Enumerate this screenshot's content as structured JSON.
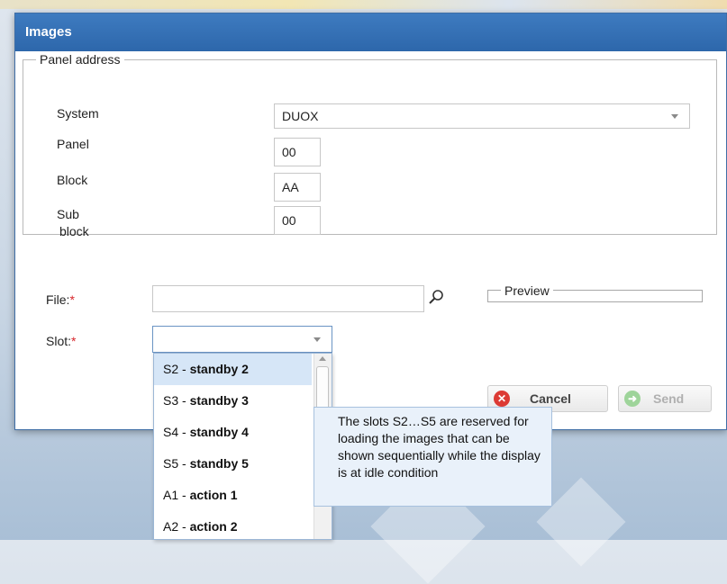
{
  "dialog": {
    "title": "Images",
    "panel_address": {
      "legend": "Panel address",
      "system": {
        "label": "System",
        "value": "DUOX"
      },
      "panel": {
        "label": "Panel",
        "value": "00"
      },
      "block": {
        "label": "Block",
        "value": "AA"
      },
      "sub_block": {
        "label_line1": "Sub",
        "label_line2": "block",
        "value": "00"
      }
    },
    "file": {
      "label": "File:",
      "required_mark": "*",
      "value": ""
    },
    "slot": {
      "label": "Slot:",
      "required_mark": "*",
      "value": ""
    },
    "preview": {
      "legend": "Preview"
    },
    "buttons": {
      "cancel": "Cancel",
      "send": "Send"
    },
    "slot_options": [
      {
        "code": "S2 -",
        "name": "standby 2",
        "selected": true
      },
      {
        "code": "S3 -",
        "name": "standby 3"
      },
      {
        "code": "S4 -",
        "name": "standby 4"
      },
      {
        "code": "S5 -",
        "name": "standby 5"
      },
      {
        "code": "A1 -",
        "name": "action 1"
      },
      {
        "code": "A2 -",
        "name": "action 2"
      }
    ],
    "tooltip": "The slots S2…S5 are reserved for loading the images that can be shown sequentially while the display is at idle condition"
  },
  "colors": {
    "titlebar": "#2d67ab",
    "required": "#d7262b",
    "cancel_icon": "#dc3a34",
    "send_icon": "#9ed49a",
    "selected_option": "#d6e6f7",
    "tooltip_bg": "#e9f1fa"
  },
  "icons": [
    "search-icon",
    "cancel-icon",
    "send-icon",
    "chevron-down-icon",
    "scroll-up-icon"
  ]
}
